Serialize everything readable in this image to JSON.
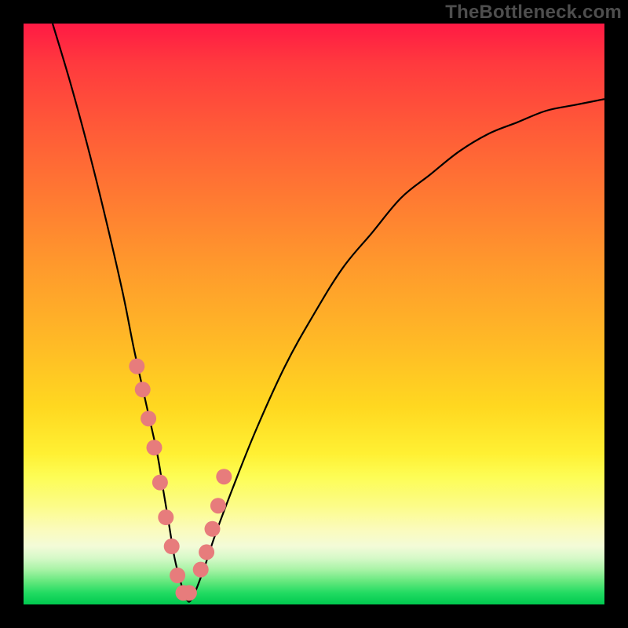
{
  "watermark": "TheBottleneck.com",
  "chart_data": {
    "type": "line",
    "title": "",
    "xlabel": "",
    "ylabel": "",
    "xlim": [
      0,
      100
    ],
    "ylim": [
      0,
      100
    ],
    "grid": false,
    "series": [
      {
        "name": "bottleneck-curve",
        "x": [
          5,
          8,
          11,
          14,
          17,
          19,
          21,
          23,
          24,
          25,
          26,
          27,
          28,
          29,
          31,
          33,
          36,
          40,
          45,
          50,
          55,
          60,
          65,
          70,
          75,
          80,
          85,
          90,
          95,
          100
        ],
        "values": [
          100,
          90,
          79,
          67,
          54,
          44,
          35,
          26,
          20,
          14,
          8,
          4,
          1,
          1,
          6,
          12,
          20,
          30,
          41,
          50,
          58,
          64,
          70,
          74,
          78,
          81,
          83,
          85,
          86,
          87
        ]
      }
    ],
    "highlight_points": {
      "x": [
        19.5,
        20.5,
        21.5,
        22.5,
        23.5,
        24.5,
        25.5,
        26.5,
        27.5,
        28.5,
        30.5,
        31.5,
        32.5,
        33.5,
        34.5
      ],
      "values": [
        41,
        37,
        32,
        27,
        21,
        15,
        10,
        5,
        2,
        2,
        6,
        9,
        13,
        17,
        22
      ]
    },
    "annotations": []
  },
  "colors": {
    "curve": "#000000",
    "highlight": "#e77c7c",
    "background_top": "#ff1a44",
    "background_bottom": "#00c94f",
    "frame": "#000000",
    "watermark": "#4e4e4e"
  }
}
